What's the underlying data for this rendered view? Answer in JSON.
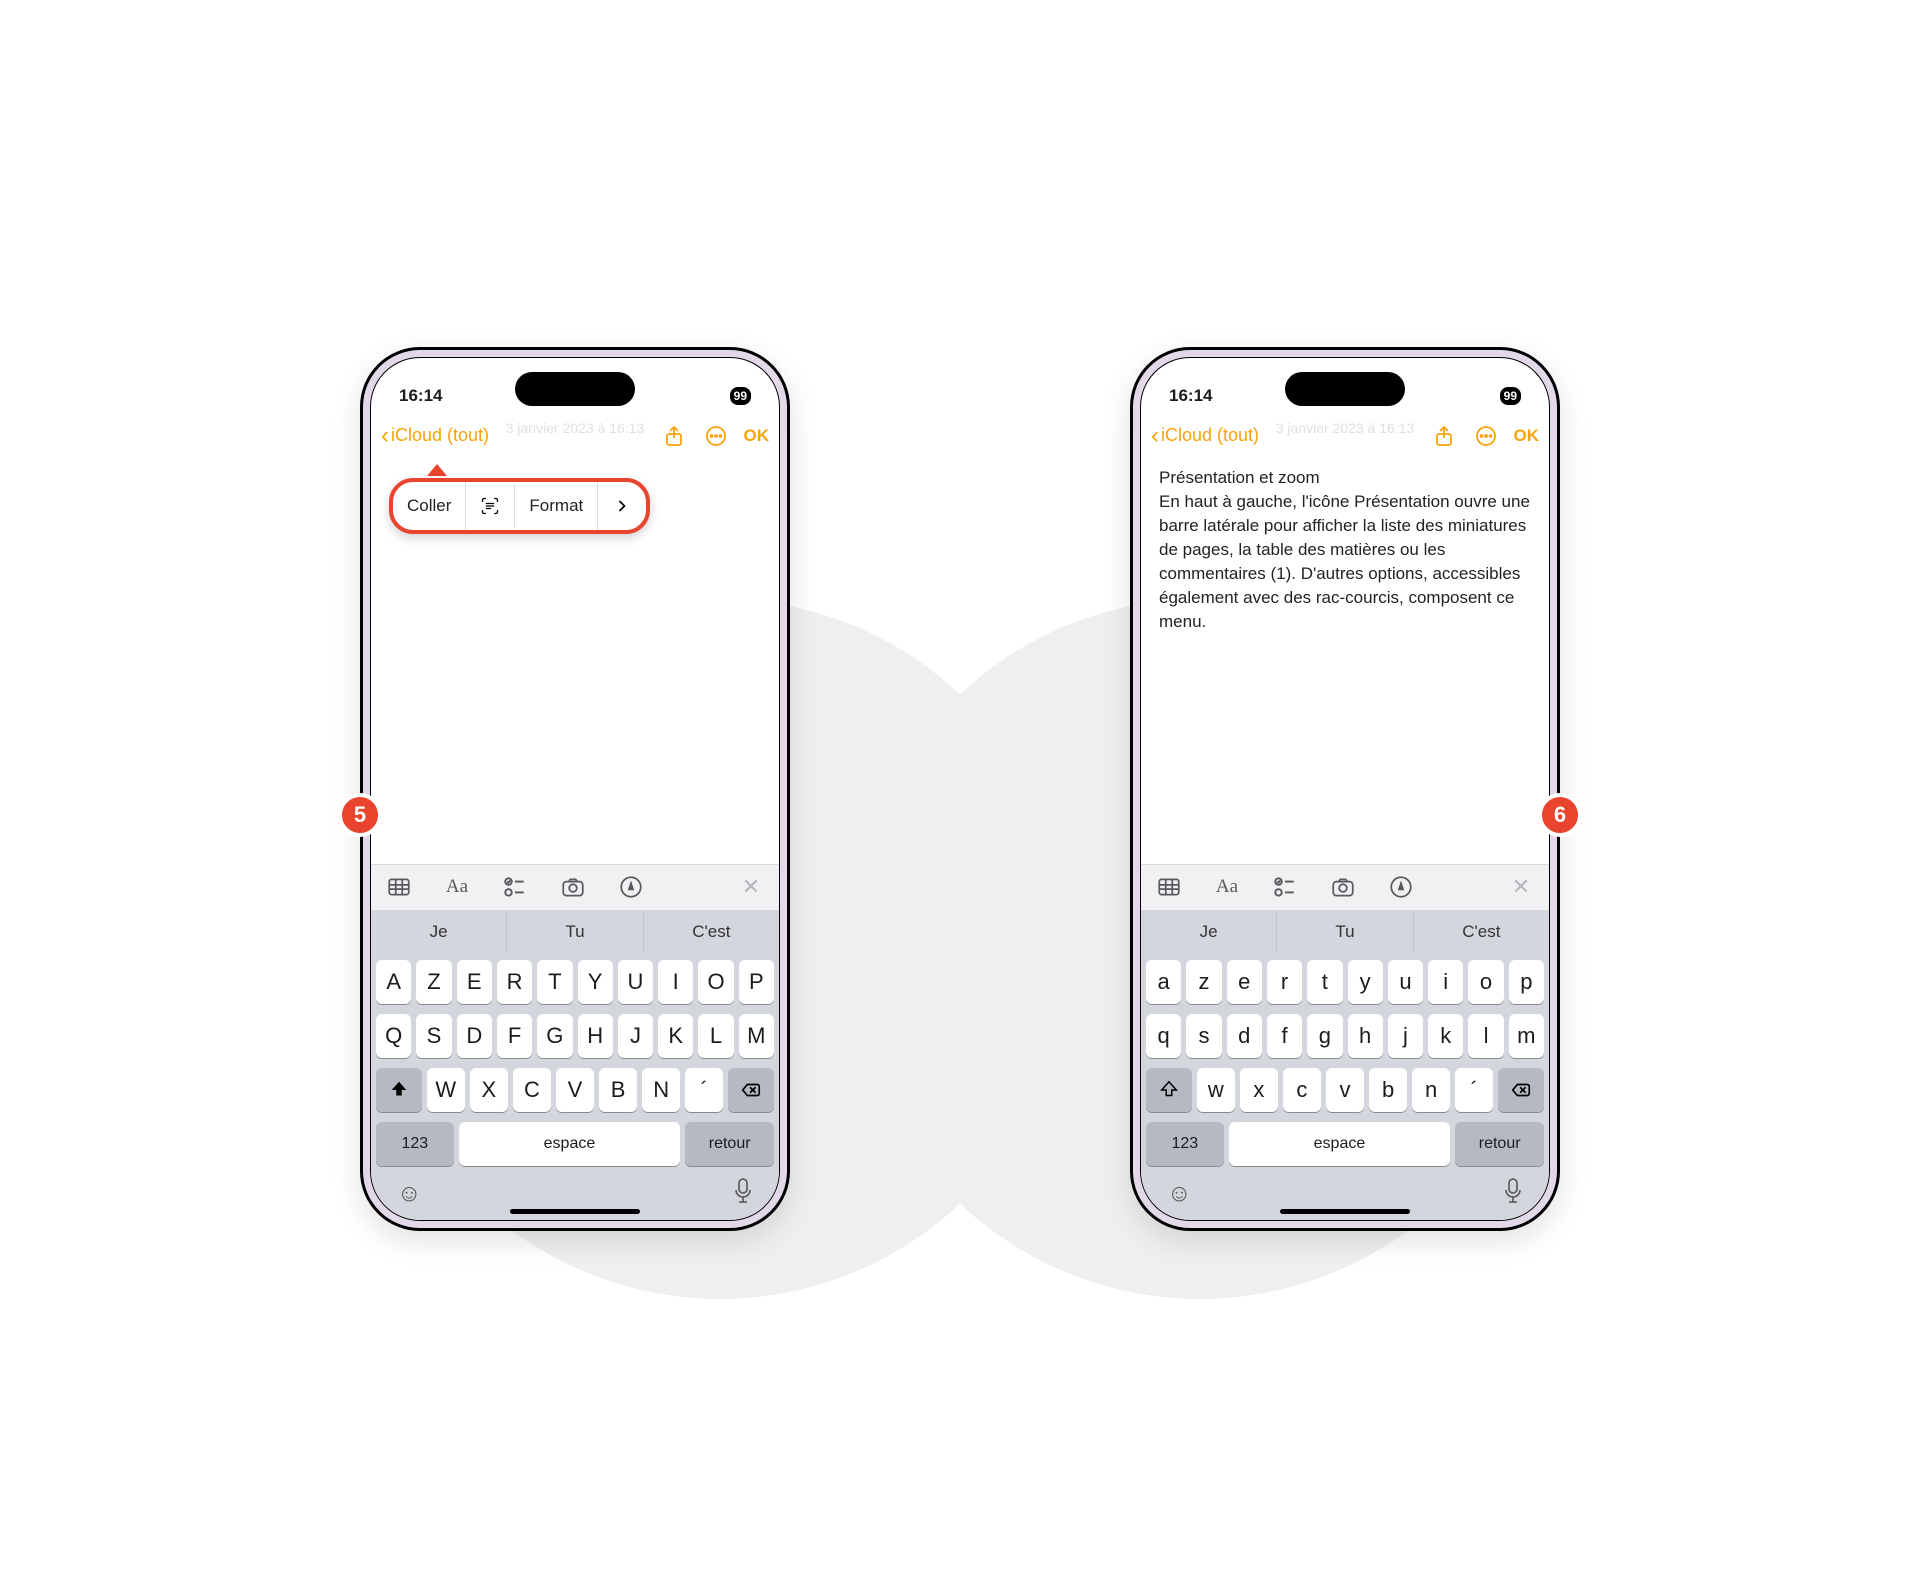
{
  "badges": {
    "left": "5",
    "right": "6"
  },
  "status": {
    "time": "16:14",
    "battery_pct": "99"
  },
  "nav": {
    "back_label": "iCloud (tout)",
    "done_label": "OK",
    "faded_date": "3 janvier 2023 à 16:13"
  },
  "note_phone2": {
    "title": "Présentation et zoom",
    "body": "En haut à gauche, l'icône Présentation ouvre une barre latérale pour afficher la liste des miniatures de pages, la table des matières ou les commentaires (1). D'autres options, accessibles également avec des rac-courcis, composent ce menu."
  },
  "popup": {
    "paste": "Coller",
    "format": "Format"
  },
  "kbd": {
    "upper": true,
    "suggestions": [
      "Je",
      "Tu",
      "C'est"
    ],
    "row1_upper": [
      "A",
      "Z",
      "E",
      "R",
      "T",
      "Y",
      "U",
      "I",
      "O",
      "P"
    ],
    "row2_upper": [
      "Q",
      "S",
      "D",
      "F",
      "G",
      "H",
      "J",
      "K",
      "L",
      "M"
    ],
    "row3_upper": [
      "W",
      "X",
      "C",
      "V",
      "B",
      "N",
      "´"
    ],
    "row1_lower": [
      "a",
      "z",
      "e",
      "r",
      "t",
      "y",
      "u",
      "i",
      "o",
      "p"
    ],
    "row2_lower": [
      "q",
      "s",
      "d",
      "f",
      "g",
      "h",
      "j",
      "k",
      "l",
      "m"
    ],
    "row3_lower": [
      "w",
      "x",
      "c",
      "v",
      "b",
      "n",
      "´"
    ],
    "numbers_label": "123",
    "space_label": "espace",
    "return_label": "retour"
  }
}
